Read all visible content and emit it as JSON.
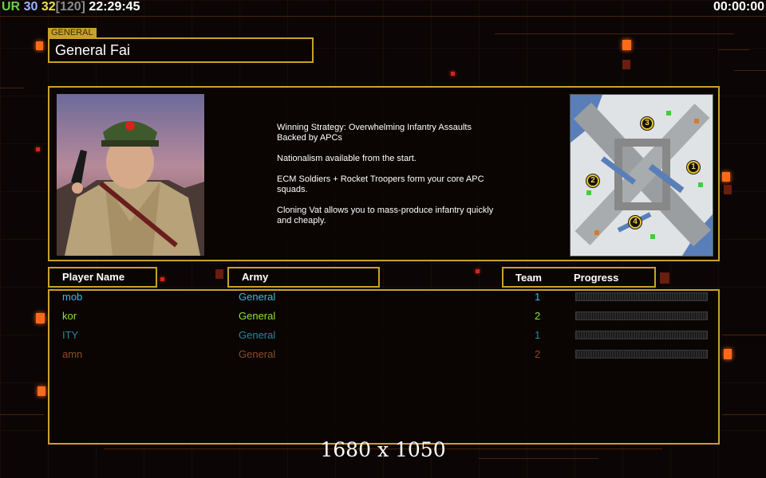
{
  "hud": {
    "ur_label": "UR",
    "value_a": "30",
    "value_b": "32",
    "value_c": "[120]",
    "clock": "22:29:45",
    "timer": "00:00:00"
  },
  "general": {
    "tag": "GENERAL",
    "name": "General Fai"
  },
  "strategy": [
    "Winning Strategy: Overwhelming Infantry Assaults\n Backed by APCs",
    "Nationalism available from the start.",
    "ECM Soldiers + Rocket Troopers form your core APC\n squads.",
    "Cloning Vat allows you to mass-produce infantry quickly\n and cheaply."
  ],
  "minimap": {
    "markers": [
      "3",
      "1",
      "2",
      "4"
    ]
  },
  "table": {
    "headers": {
      "player": "Player Name",
      "army": "Army",
      "team": "Team",
      "progress": "Progress"
    },
    "rows": [
      {
        "name": "mob",
        "army": "General",
        "team": "1",
        "color": "#3fb6e0",
        "progress": 0
      },
      {
        "name": "kor",
        "army": "General",
        "team": "2",
        "color": "#8ce23a",
        "progress": 0
      },
      {
        "name": "ITY",
        "army": "General",
        "team": "1",
        "color": "#1f8a9c",
        "progress": 0
      },
      {
        "name": "amn",
        "army": "General",
        "team": "2",
        "color": "#8f4a2a",
        "progress": 0
      }
    ]
  },
  "resolution": "1680 x 1050",
  "colors": {
    "frame": "#c9a12a",
    "army": "#3fb6e0",
    "accent": "#ff6a1a"
  }
}
